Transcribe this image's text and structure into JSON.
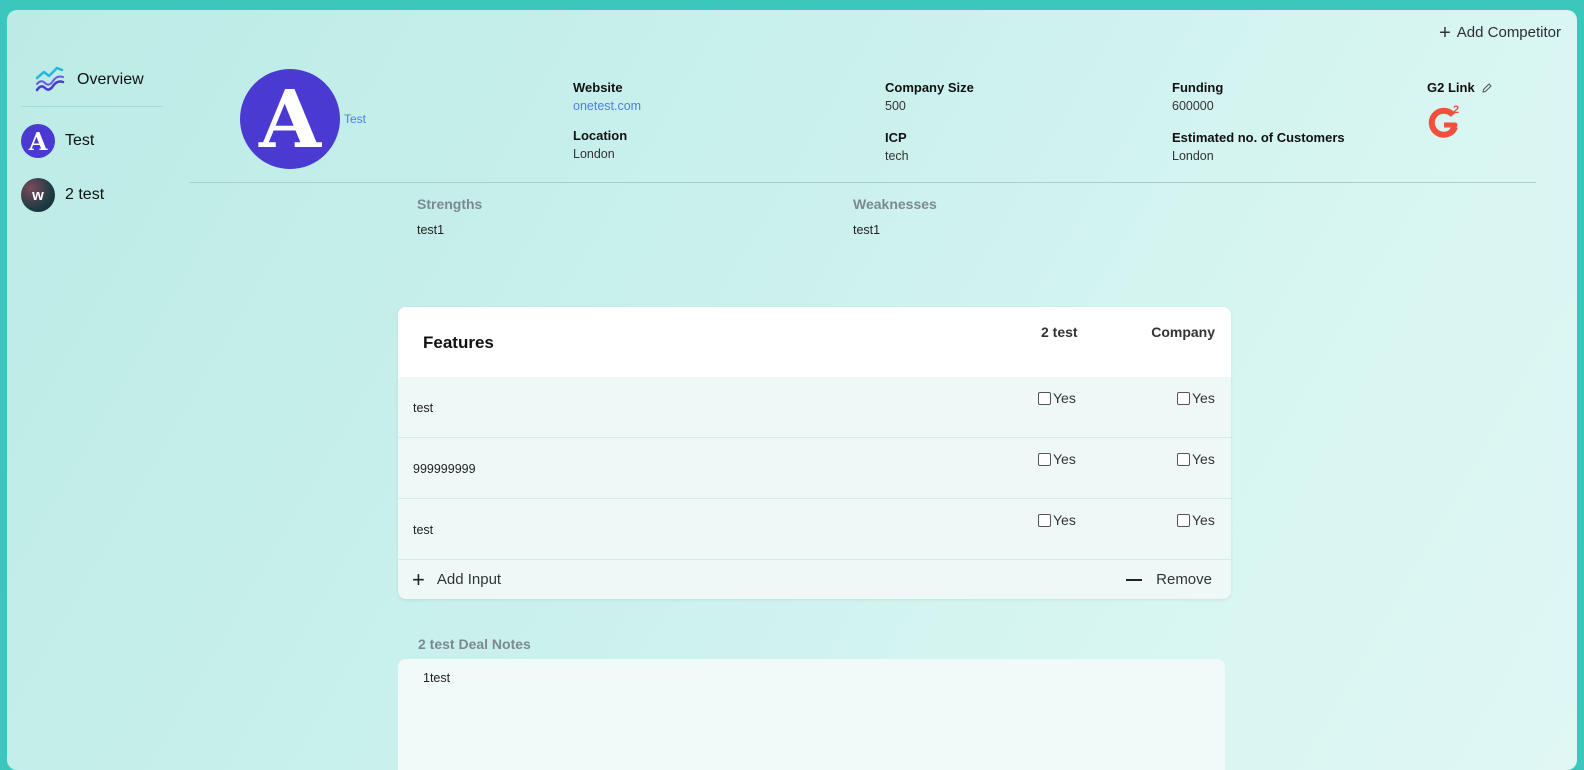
{
  "header": {
    "add_competitor_label": "Add Competitor"
  },
  "sidebar": {
    "overview_label": "Overview",
    "items": [
      {
        "label": "Test",
        "logo_letter": "A"
      },
      {
        "label": "2 test",
        "logo_letter": "w"
      }
    ]
  },
  "company": {
    "logo_letter": "A",
    "name": "Test",
    "website_label": "Website",
    "website": "onetest.com",
    "location_label": "Location",
    "location": "London",
    "company_size_label": "Company Size",
    "company_size": "500",
    "icp_label": "ICP",
    "icp": "tech",
    "funding_label": "Funding",
    "funding": "600000",
    "customers_label": "Estimated no. of Customers",
    "customers": "London",
    "g2_label": "G2 Link"
  },
  "strengths": {
    "title": "Strengths",
    "value": "test1"
  },
  "weaknesses": {
    "title": "Weaknesses",
    "value": "test1"
  },
  "features": {
    "title": "Features",
    "col_a": "2 test",
    "col_b": "Company",
    "yes_label": "Yes",
    "rows": [
      {
        "name": "test"
      },
      {
        "name": "999999999"
      },
      {
        "name": "test"
      }
    ],
    "add_input_label": "Add Input",
    "remove_label": "Remove"
  },
  "deal_notes": {
    "title": "2 test Deal Notes",
    "text": "1test"
  },
  "colors": {
    "brand_purple": "#4a3ad1",
    "link_blue": "#4f7fe0",
    "g2_red": "#f0503c"
  }
}
